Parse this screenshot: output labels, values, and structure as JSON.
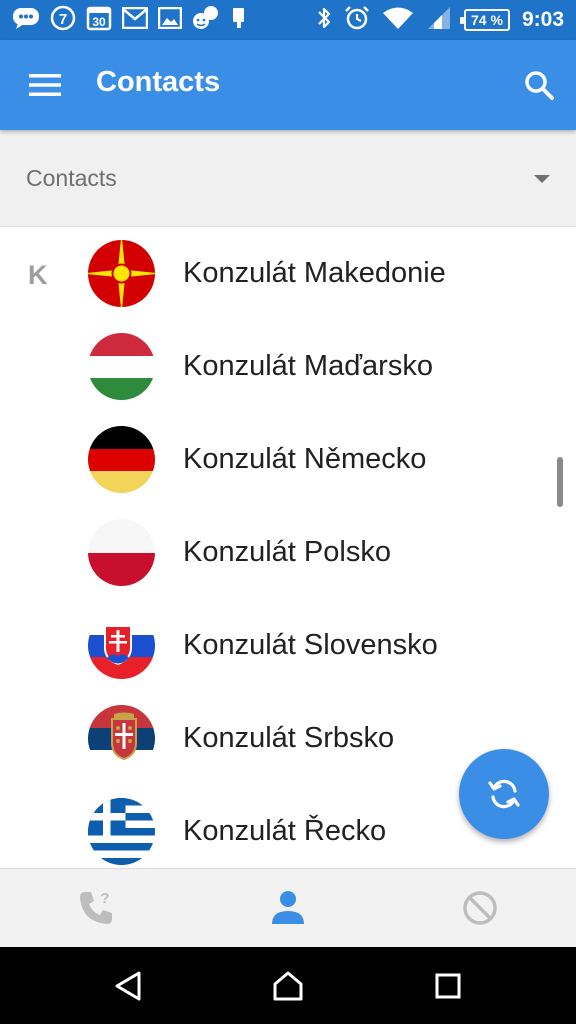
{
  "status_bar": {
    "notification_icons": [
      "chat-bubble-icon",
      "circled-7-icon",
      "calendar-30-icon",
      "gmail-icon",
      "image-icon",
      "messenger-icon",
      "device-icon"
    ],
    "calendar_day": "30",
    "circled_number": "7",
    "battery_percent": "74 %",
    "time": "9:03",
    "system_icons": [
      "bluetooth-icon",
      "alarm-icon",
      "wifi-icon",
      "signal-icon",
      "battery-icon"
    ]
  },
  "app_bar": {
    "title": "Contacts",
    "background": "#3b8ee6"
  },
  "filter": {
    "selected": "Contacts"
  },
  "list": {
    "section_letter": "K",
    "contacts": [
      {
        "name": "Konzulát Makedonie",
        "flag": "north-macedonia"
      },
      {
        "name": "Konzulát Maďarsko",
        "flag": "hungary"
      },
      {
        "name": "Konzulát Německo",
        "flag": "germany"
      },
      {
        "name": "Konzulát Polsko",
        "flag": "poland"
      },
      {
        "name": "Konzulát Slovensko",
        "flag": "slovakia"
      },
      {
        "name": "Konzulát Srbsko",
        "flag": "serbia"
      },
      {
        "name": "Konzulát Řecko",
        "flag": "greece"
      }
    ]
  },
  "fab": {
    "icon": "sync-icon",
    "color": "#3b8ee6"
  },
  "bottom_tabs": {
    "items": [
      {
        "icon": "phone-question-icon",
        "active": false
      },
      {
        "icon": "person-icon",
        "active": true
      },
      {
        "icon": "block-icon",
        "active": false
      }
    ],
    "active_color": "#3b8ee6",
    "inactive_color": "#bdbdbd"
  },
  "nav_bar": {
    "buttons": [
      "back-icon",
      "home-icon",
      "recents-icon"
    ]
  }
}
